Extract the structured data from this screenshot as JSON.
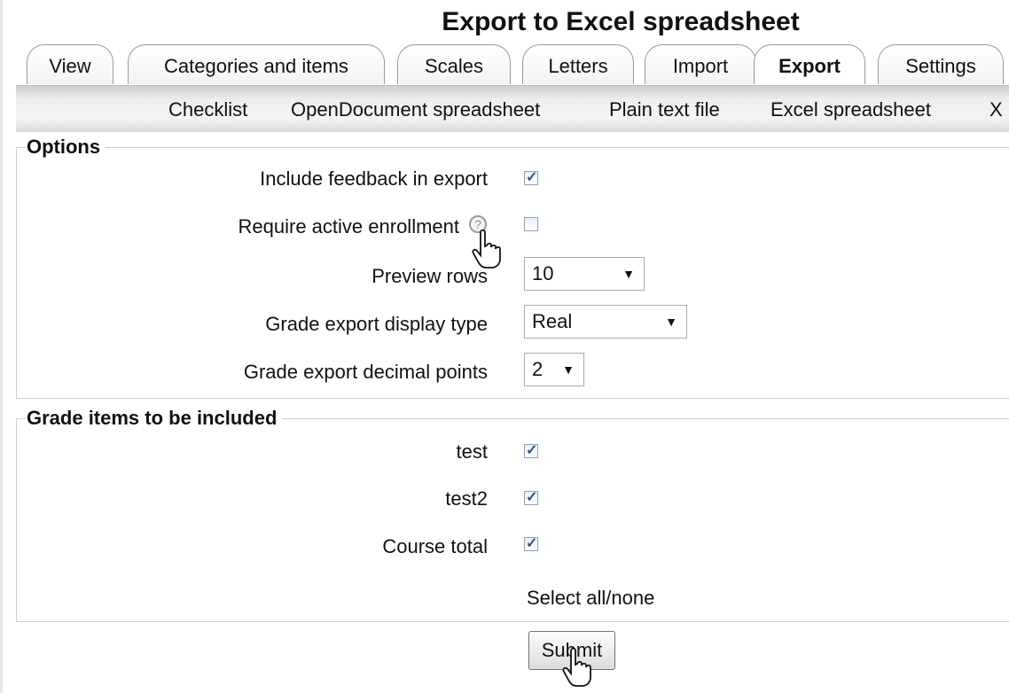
{
  "page": {
    "title": "Export to Excel spreadsheet"
  },
  "tabs": [
    {
      "label": "View"
    },
    {
      "label": "Categories and items"
    },
    {
      "label": "Scales"
    },
    {
      "label": "Letters"
    },
    {
      "label": "Import"
    },
    {
      "label": "Export",
      "active": true
    },
    {
      "label": "Settings"
    }
  ],
  "subtabs": [
    {
      "label": "Checklist"
    },
    {
      "label": "OpenDocument spreadsheet"
    },
    {
      "label": "Plain text file"
    },
    {
      "label": "Excel spreadsheet"
    },
    {
      "label": "X"
    }
  ],
  "options": {
    "legend": "Options",
    "include_feedback": {
      "label": "Include feedback in export",
      "checked": true
    },
    "require_active": {
      "label": "Require active enrollment",
      "checked": false
    },
    "preview_rows": {
      "label": "Preview rows",
      "value": "10"
    },
    "display_type": {
      "label": "Grade export display type",
      "value": "Real"
    },
    "decimal_points": {
      "label": "Grade export decimal points",
      "value": "2"
    }
  },
  "grade_items": {
    "legend": "Grade items to be included",
    "items": [
      {
        "label": "test",
        "checked": true
      },
      {
        "label": "test2",
        "checked": true
      },
      {
        "label": "Course total",
        "checked": true
      }
    ],
    "select_all": "Select all/none"
  },
  "submit_label": "Submit",
  "icons": {
    "help": "help-icon",
    "cursor": "hand-pointer-cursor-icon",
    "dropdown": "chevron-down-icon",
    "checkbox_tick": "✓"
  },
  "colors": {
    "checkbox_border": "#8ca2bb",
    "tick": "#3b4f74"
  }
}
